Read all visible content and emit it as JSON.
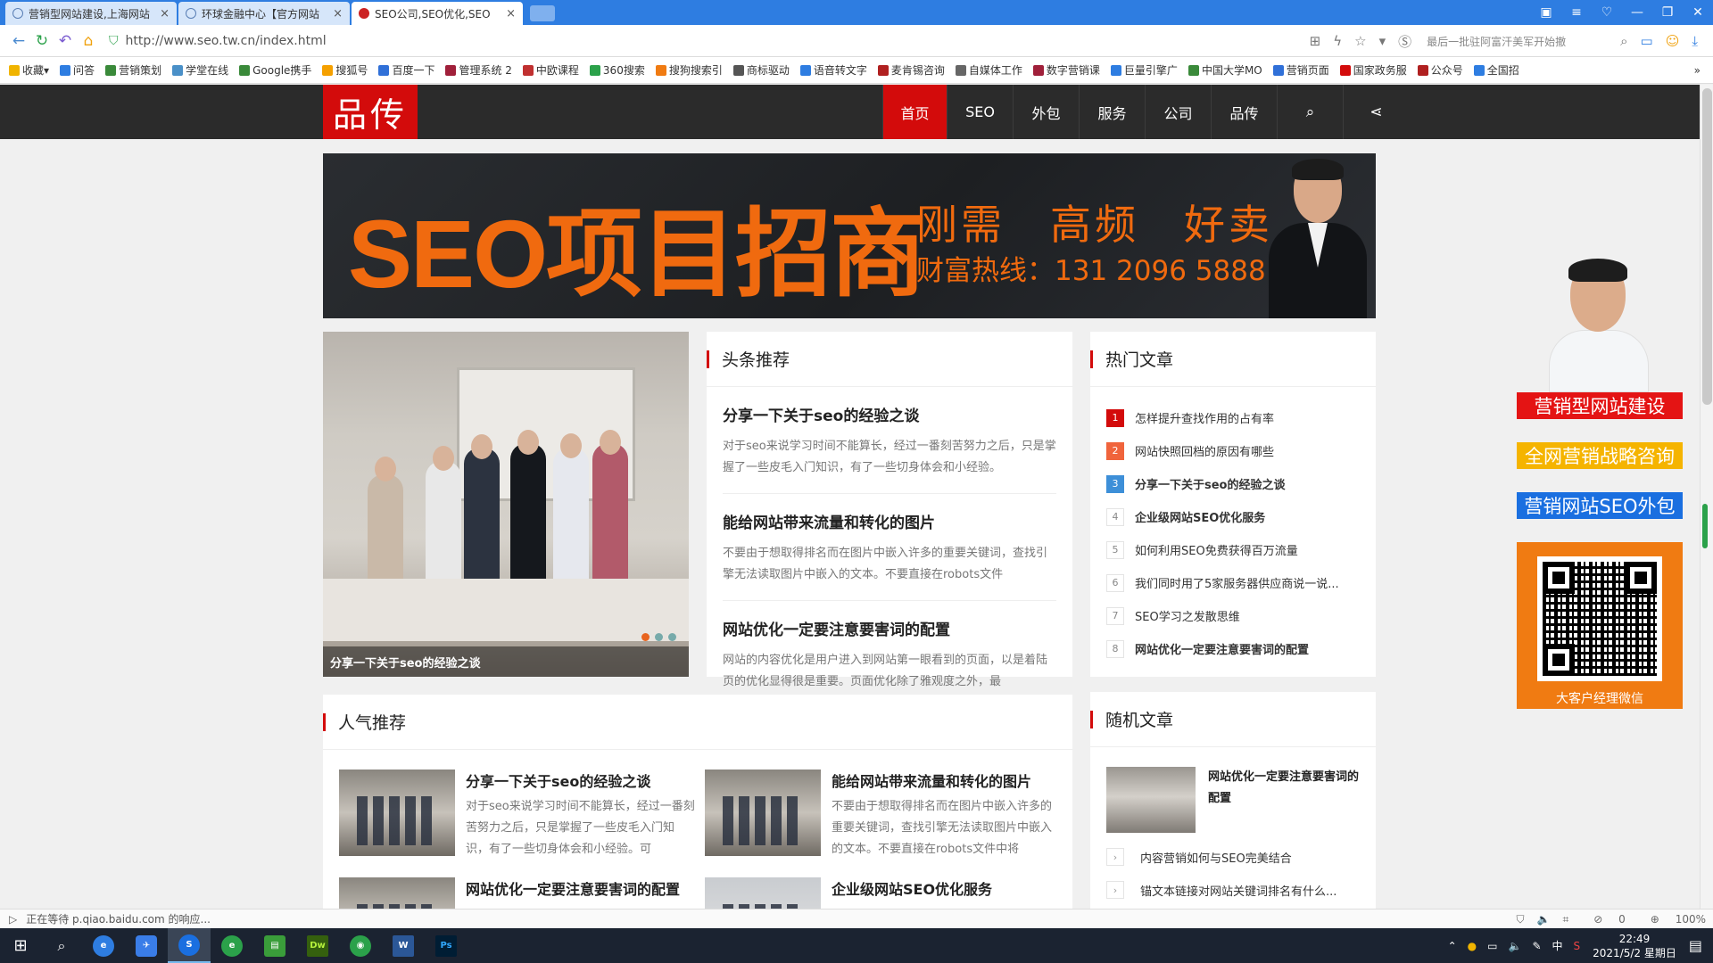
{
  "browser": {
    "tabs": [
      {
        "title": "营销型网站建设,上海网站",
        "active": false
      },
      {
        "title": "环球金融中心【官方网站",
        "active": false
      },
      {
        "title": "SEO公司,SEO优化,SEO",
        "active": true
      }
    ],
    "url": "http://www.seo.tw.cn/index.html",
    "address_hint": "最后一批驻阿富汗美军开始撤",
    "bookmarks": [
      "收藏",
      "问答",
      "营销策划",
      "学堂在线",
      "Google携手",
      "搜狐号",
      "百度一下",
      "管理系统 2",
      "中欧课程",
      "360搜索",
      "搜狗搜索引",
      "商标驱动",
      "语音转文字",
      "麦肯锡咨询",
      "自媒体工作",
      "数字营销课",
      "巨量引擎广",
      "中国大学MO",
      "营销页面",
      "国家政务服",
      "公众号",
      "全国招"
    ],
    "status_text": "正在等待 p.qiao.baidu.com 的响应...",
    "status_right": {
      "shield": "0",
      "zoom": "100%"
    }
  },
  "site": {
    "logo": "品传",
    "menu": [
      "首页",
      "SEO",
      "外包",
      "服务",
      "公司",
      "品传"
    ],
    "banner": {
      "main": "SEO项目招商",
      "tagline": "刚需　高频　好卖",
      "phone": "财富热线：131 2096 5888"
    },
    "slider": {
      "caption": "分享一下关于seo的经验之谈"
    },
    "headline": {
      "title": "头条推荐",
      "items": [
        {
          "title": "分享一下关于seo的经验之谈",
          "excerpt": "对于seo来说学习时间不能算长，经过一番刻苦努力之后，只是掌握了一些皮毛入门知识，有了一些切身体会和小经验。"
        },
        {
          "title": "能给网站带来流量和转化的图片",
          "excerpt": "不要由于想取得排名而在图片中嵌入许多的重要关键词，查找引擎无法读取图片中嵌入的文本。不要直接在robots文件"
        },
        {
          "title": "网站优化一定要注意要害词的配置",
          "excerpt": "网站的内容优化是用户进入到网站第一眼看到的页面，以是着陆页的优化显得很是重要。页面优化除了雅观度之外，最"
        }
      ]
    },
    "hot": {
      "title": "热门文章",
      "items": [
        {
          "n": "1",
          "t": "怎样提升查找作用的占有率",
          "bold": false
        },
        {
          "n": "2",
          "t": "网站快照回档的原因有哪些",
          "bold": false
        },
        {
          "n": "3",
          "t": "分享一下关于seo的经验之谈",
          "bold": true
        },
        {
          "n": "4",
          "t": "企业级网站SEO优化服务",
          "bold": true
        },
        {
          "n": "5",
          "t": "如何利用SEO免费获得百万流量",
          "bold": false
        },
        {
          "n": "6",
          "t": "我们同时用了5家服务器供应商说一说...",
          "bold": false
        },
        {
          "n": "7",
          "t": "SEO学习之发散思维",
          "bold": false
        },
        {
          "n": "8",
          "t": "网站优化一定要注意要害词的配置",
          "bold": true
        }
      ]
    },
    "popular": {
      "title": "人气推荐",
      "items": [
        {
          "title": "分享一下关于seo的经验之谈",
          "excerpt": "对于seo来说学习时间不能算长，经过一番刻苦努力之后，只是掌握了一些皮毛入门知识，有了一些切身体会和小经验。可"
        },
        {
          "title": "能给网站带来流量和转化的图片",
          "excerpt": "不要由于想取得排名而在图片中嵌入许多的重要关键词，查找引擎无法读取图片中嵌入的文本。不要直接在robots文件中将"
        },
        {
          "title": "网站优化一定要注意要害词的配置",
          "excerpt": ""
        },
        {
          "title": "企业级网站SEO优化服务",
          "excerpt": ""
        }
      ]
    },
    "random": {
      "title": "随机文章",
      "top_title": "网站优化一定要注意要害词的配置",
      "items": [
        "内容营销如何与SEO完美结合",
        "锚文本链接对网站关键词排名有什么..."
      ]
    },
    "float_ad": {
      "buttons": [
        "营销型网站建设",
        "全网营销战略咨询",
        "营销网站SEO外包"
      ],
      "qr_label": "大客户经理微信"
    }
  },
  "taskbar": {
    "time": "22:49",
    "date": "2021/5/2 星期日",
    "ime": "中"
  }
}
